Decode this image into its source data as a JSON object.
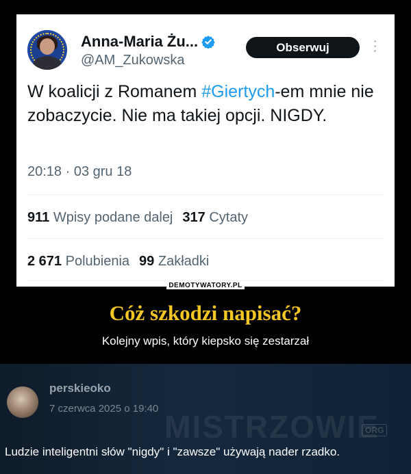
{
  "tweet": {
    "display_name": "Anna-Maria Żu...",
    "handle": "@AM_Zukowska",
    "follow_label": "Obserwuj",
    "text_before_hashtag": "W koalicji z Romanem ",
    "hashtag": "#Giertych",
    "text_after_hashtag": "-em mnie nie zobaczycie. Nie ma takiej opcji. NIGDY.",
    "timestamp": "20:18 · 03 gru 18",
    "stats": {
      "reposts_count": "911",
      "reposts_label": "Wpisy podane dalej",
      "quotes_count": "317",
      "quotes_label": "Cytaty",
      "likes_count": "2 671",
      "likes_label": "Polubienia",
      "bookmarks_count": "99",
      "bookmarks_label": "Zakładki"
    },
    "accent_color": "#1d9bf0"
  },
  "demotivator": {
    "site_label": "DEMOTYWATORY.PL",
    "headline": "Cóż szkodzi napisać?",
    "subheadline": "Kolejny wpis, który kiepsko się zestarzał",
    "headline_color": "#f3c623"
  },
  "comment": {
    "username": "perskieoko",
    "date": "7 czerwca 2025 o 19:40",
    "watermark": "MISTRZOWIE",
    "watermark_badge": "ORG",
    "text": "Ludzie inteligentni słów \"nigdy\" i \"zawsze\" używają nader rzadko."
  }
}
